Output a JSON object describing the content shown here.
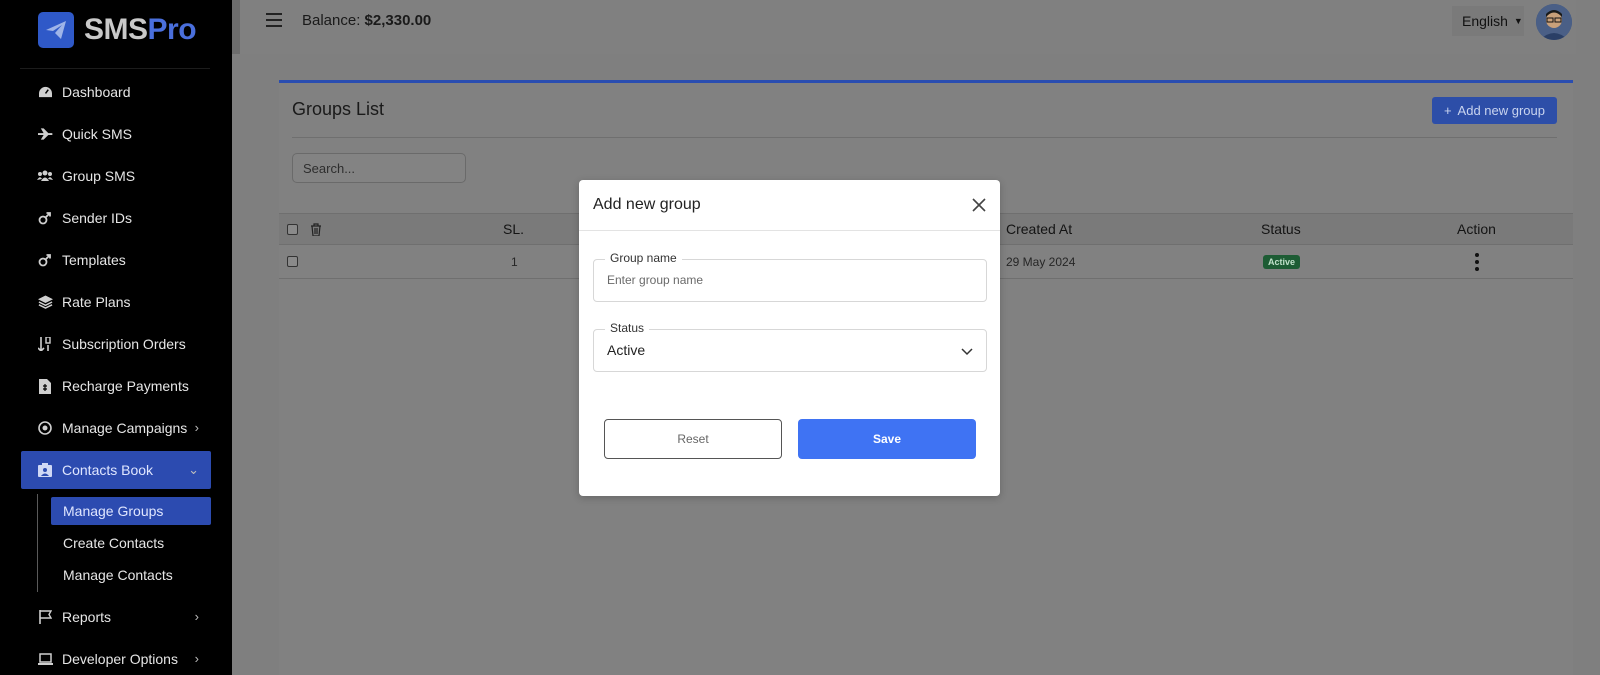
{
  "app": {
    "logo_part1": "SMS",
    "logo_part2": "Pro"
  },
  "colors": {
    "accent": "#2c4bb0",
    "primary_button": "#3f73f3",
    "status_active": "#1d5c34",
    "sidebar_bg": "#000000"
  },
  "sidebar": {
    "items": [
      {
        "label": "Dashboard",
        "icon": "dashboard-icon"
      },
      {
        "label": "Quick SMS",
        "icon": "plane-icon"
      },
      {
        "label": "Group SMS",
        "icon": "users-icon"
      },
      {
        "label": "Sender IDs",
        "icon": "mars-icon"
      },
      {
        "label": "Templates",
        "icon": "mars-icon"
      },
      {
        "label": "Rate Plans",
        "icon": "layers-icon"
      },
      {
        "label": "Subscription Orders",
        "icon": "sort-numeric-icon"
      },
      {
        "label": "Recharge Payments",
        "icon": "invoice-icon"
      },
      {
        "label": "Manage Campaigns",
        "icon": "campaign-icon"
      },
      {
        "label": "Contacts Book",
        "icon": "contacts-icon"
      },
      {
        "label": "Reports",
        "icon": "flag-icon"
      },
      {
        "label": "Developer Options",
        "icon": "laptop-icon"
      }
    ],
    "sub_items": [
      {
        "label": "Manage Groups"
      },
      {
        "label": "Create Contacts"
      },
      {
        "label": "Manage Contacts"
      }
    ]
  },
  "topbar": {
    "balance_label": "Balance:",
    "balance_value": "$2,330.00",
    "language": "English"
  },
  "page": {
    "title": "Groups List",
    "add_button": "Add new group",
    "search_placeholder": "Search..."
  },
  "table": {
    "columns": {
      "sl": "SL.",
      "created_at": "Created At",
      "status": "Status",
      "action": "Action"
    },
    "rows": [
      {
        "sl": "1",
        "created_at": "29 May 2024",
        "status": "Active"
      }
    ]
  },
  "modal": {
    "title": "Add new group",
    "group_name_label": "Group name",
    "group_name_placeholder": "Enter group name",
    "group_name_value": "",
    "status_label": "Status",
    "status_value": "Active",
    "reset_label": "Reset",
    "save_label": "Save"
  }
}
